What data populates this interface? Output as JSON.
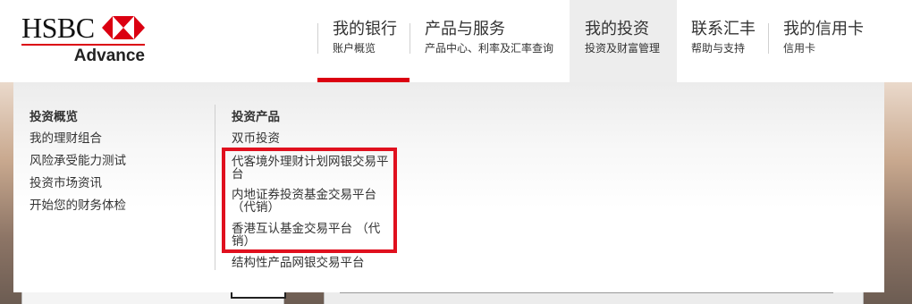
{
  "brand": {
    "bank_name": "HSBC",
    "tier": "Advance",
    "brand_color": "#db0011"
  },
  "nav": {
    "items": [
      {
        "title": "我的银行",
        "subtitle": "账户概览"
      },
      {
        "title": "产品与服务",
        "subtitle": "产品中心、利率及汇率查询"
      },
      {
        "title": "我的投资",
        "subtitle": "投资及财富管理"
      },
      {
        "title": "联系汇丰",
        "subtitle": "帮助与支持"
      },
      {
        "title": "我的信用卡",
        "subtitle": "信用卡"
      }
    ]
  },
  "dropdown": {
    "overview": {
      "heading": "投资概览",
      "links": [
        "我的理财组合",
        "风险承受能力测试",
        "投资市场资讯",
        "开始您的财务体检"
      ]
    },
    "products": {
      "heading": "投资产品",
      "links": [
        "双币投资",
        "代客境外理财计划网银交易平台",
        "内地证券投资基金交易平台 （代销）",
        "香港互认基金交易平台 （代销）",
        "结构性产品网银交易平台"
      ]
    },
    "highlight_color": "#e0101e"
  }
}
